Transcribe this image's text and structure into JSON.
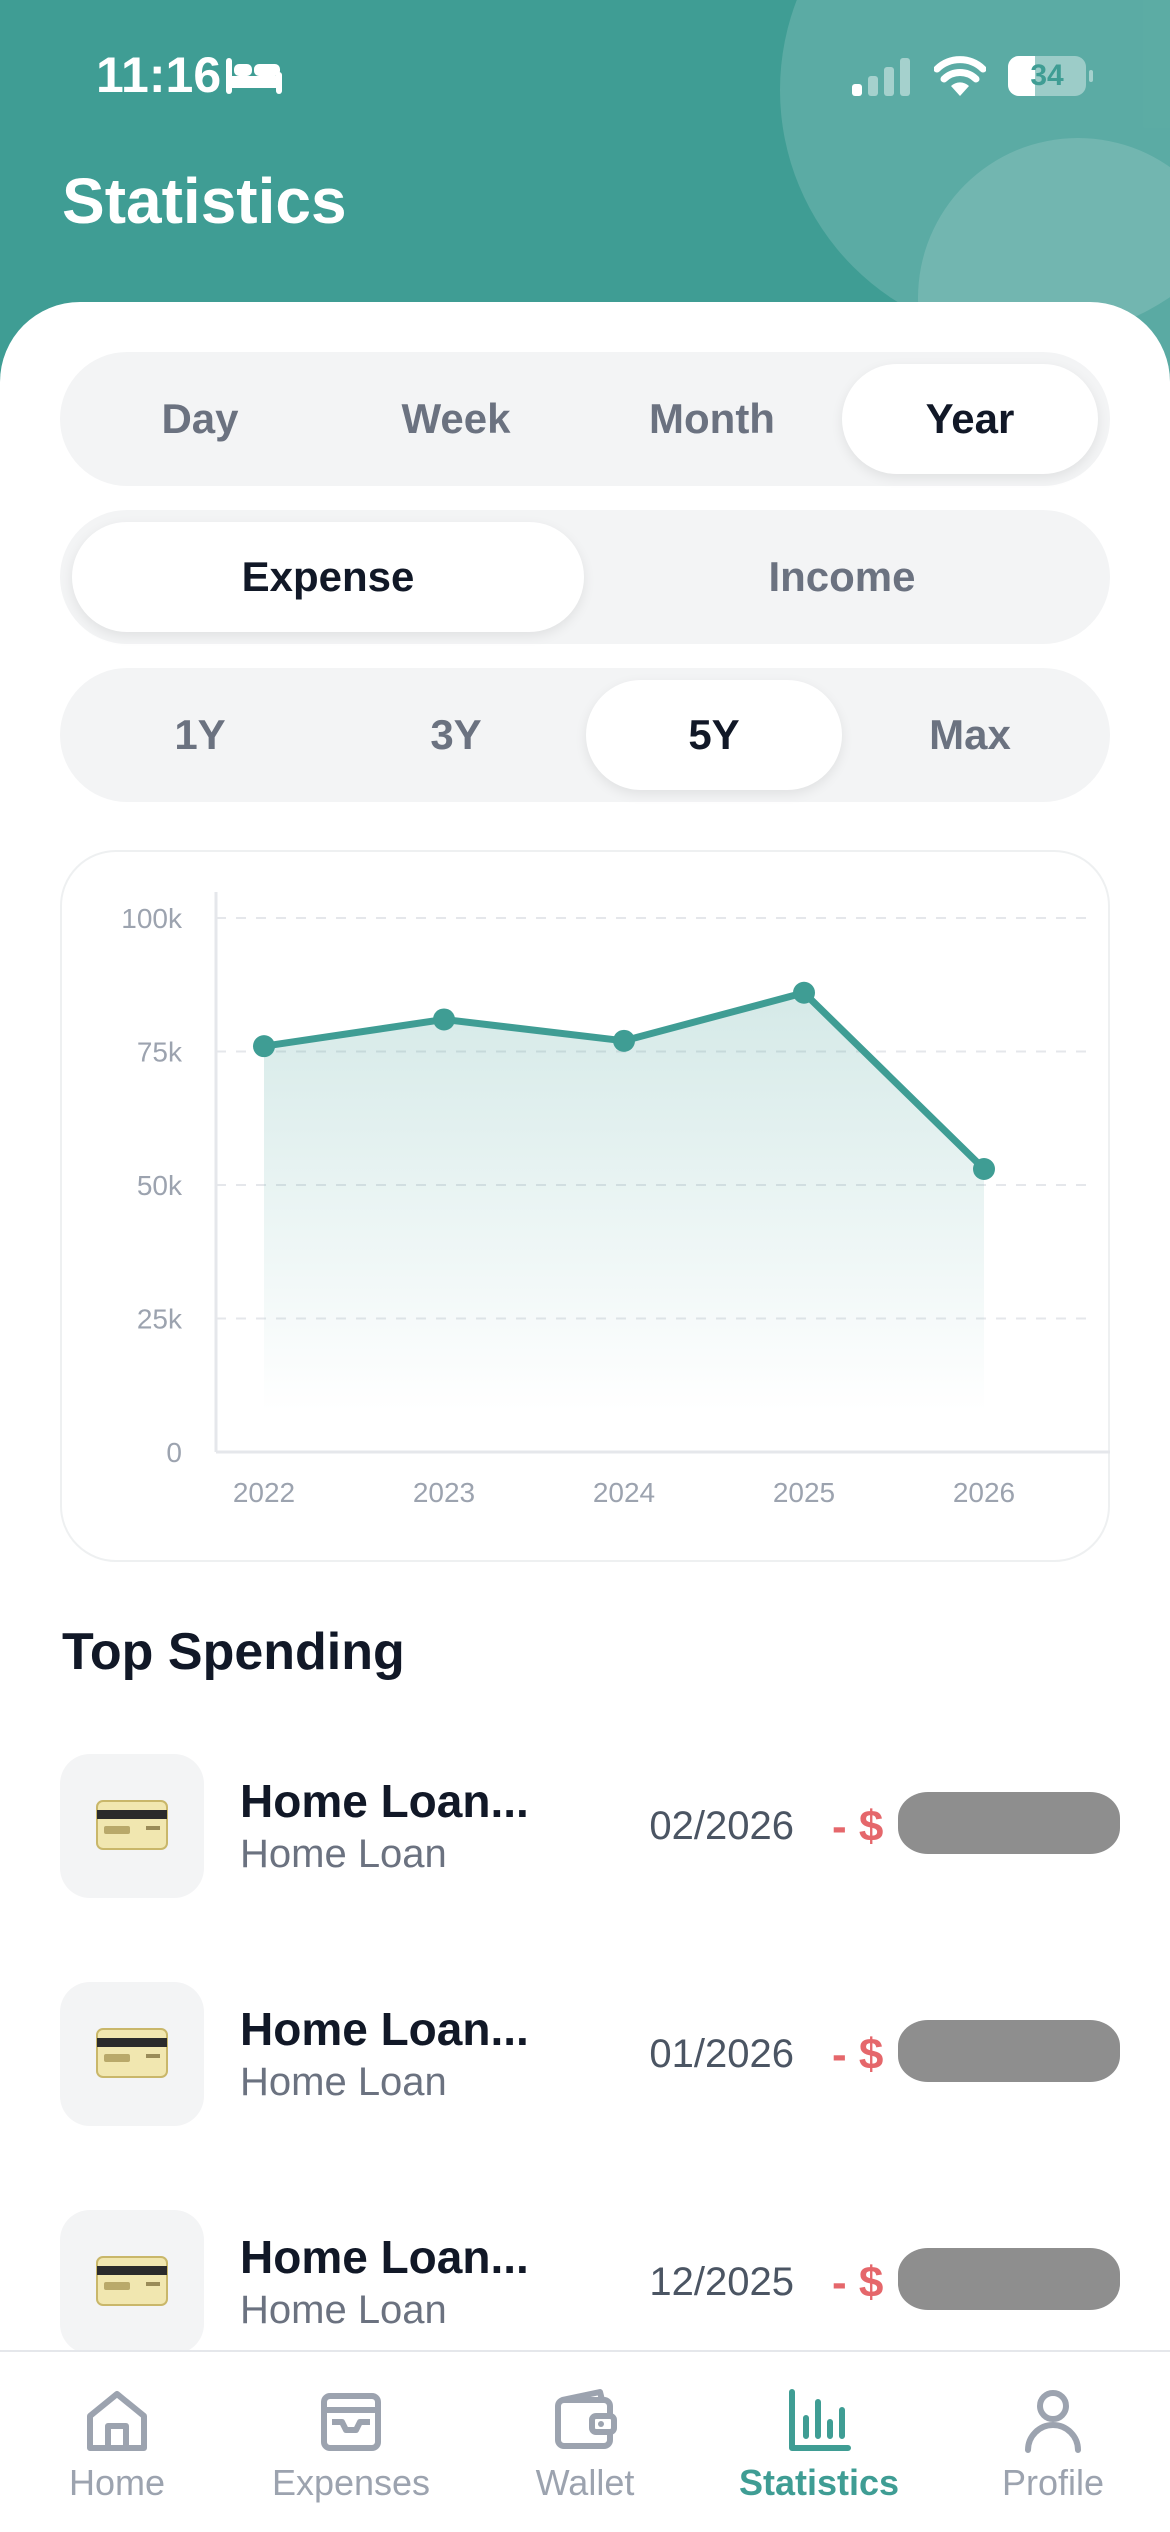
{
  "status_bar": {
    "time": "11:16",
    "battery": "34",
    "battery_level": 0.34
  },
  "header": {
    "title": "Statistics"
  },
  "period_tabs": {
    "items": [
      {
        "label": "Day",
        "active": false
      },
      {
        "label": "Week",
        "active": false
      },
      {
        "label": "Month",
        "active": false
      },
      {
        "label": "Year",
        "active": true
      }
    ]
  },
  "type_tabs": {
    "items": [
      {
        "label": "Expense",
        "active": true
      },
      {
        "label": "Income",
        "active": false
      }
    ]
  },
  "range_tabs": {
    "items": [
      {
        "label": "1Y",
        "active": false
      },
      {
        "label": "3Y",
        "active": false
      },
      {
        "label": "5Y",
        "active": true
      },
      {
        "label": "Max",
        "active": false
      }
    ]
  },
  "colors": {
    "accent": "#3f9d94",
    "expense": "#e5676b"
  },
  "chart_data": {
    "type": "area",
    "x": [
      "2022",
      "2023",
      "2024",
      "2025",
      "2026"
    ],
    "values": [
      76000,
      81000,
      77000,
      86000,
      53000
    ],
    "y_ticks": [
      "0",
      "25k",
      "50k",
      "75k",
      "100k"
    ],
    "ylim": [
      0,
      100000
    ],
    "grid": true,
    "legend": "none"
  },
  "top_spending": {
    "title": "Top Spending",
    "items": [
      {
        "title": "Home Loan...",
        "category": "Home Loan",
        "date": "02/2026",
        "amount_prefix": "- $",
        "icon": "credit-card-icon"
      },
      {
        "title": "Home Loan...",
        "category": "Home Loan",
        "date": "01/2026",
        "amount_prefix": "- $",
        "icon": "credit-card-icon"
      },
      {
        "title": "Home Loan...",
        "category": "Home Loan",
        "date": "12/2025",
        "amount_prefix": "- $",
        "icon": "credit-card-icon"
      }
    ]
  },
  "tabbar": {
    "items": [
      {
        "label": "Home",
        "icon": "home-icon",
        "active": false
      },
      {
        "label": "Expenses",
        "icon": "inbox-icon",
        "active": false
      },
      {
        "label": "Wallet",
        "icon": "wallet-icon",
        "active": false
      },
      {
        "label": "Statistics",
        "icon": "bar-chart-icon",
        "active": true
      },
      {
        "label": "Profile",
        "icon": "profile-icon",
        "active": false
      }
    ]
  }
}
